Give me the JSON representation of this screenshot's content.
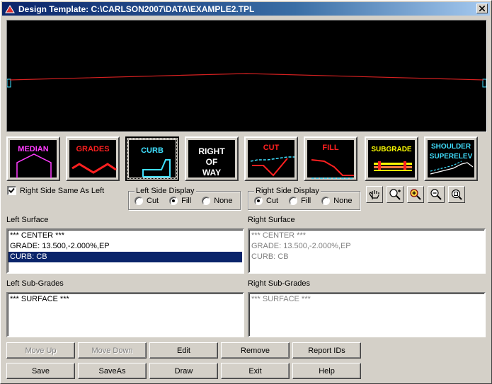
{
  "window": {
    "title": "Design Template: C:\\CARLSON2007\\DATA\\EXAMPLE2.TPL"
  },
  "template_buttons": [
    {
      "label": "MEDIAN",
      "color": "#ff3cff"
    },
    {
      "label": "GRADES",
      "color": "#ff2020"
    },
    {
      "label": "CURB",
      "color": "#40e0ff"
    },
    {
      "label_lines": [
        "RIGHT",
        "OF",
        "WAY"
      ],
      "color": "#ffffff"
    },
    {
      "label": "CUT",
      "color": "#ff2020"
    },
    {
      "label": "FILL",
      "color": "#ff2020"
    },
    {
      "label": "SUBGRADE",
      "color": "#ffff00"
    },
    {
      "label_lines": [
        "SHOULDER",
        "SUPERELEV"
      ],
      "color": "#40e0ff"
    }
  ],
  "options": {
    "right_same_as_left": {
      "label": "Right Side Same As Left",
      "checked": true
    },
    "left_display": {
      "legend": "Left Side Display",
      "options": [
        "Cut",
        "Fill",
        "None"
      ],
      "selected": "Fill"
    },
    "right_display": {
      "legend": "Right Side Display",
      "options": [
        "Cut",
        "Fill",
        "None"
      ],
      "selected": "Cut"
    }
  },
  "zoom_tools": [
    "pan-icon",
    "zoom-extents-icon",
    "zoom-in-icon",
    "zoom-out-icon",
    "zoom-window-icon"
  ],
  "left_surface": {
    "label": "Left Surface",
    "items": [
      "*** CENTER ***",
      "GRADE: 13.500,-2.000%,EP",
      "CURB: CB"
    ],
    "selected_index": 2
  },
  "right_surface": {
    "label": "Right Surface",
    "items": [
      "*** CENTER ***",
      "GRADE: 13.500,-2.000%,EP",
      "CURB: CB"
    ]
  },
  "left_subgrades": {
    "label": "Left Sub-Grades",
    "items": [
      "*** SURFACE ***"
    ]
  },
  "right_subgrades": {
    "label": "Right Sub-Grades",
    "items": [
      "*** SURFACE ***"
    ]
  },
  "buttons": {
    "move_up": "Move Up",
    "move_down": "Move Down",
    "edit": "Edit",
    "remove": "Remove",
    "report_ids": "Report IDs",
    "save": "Save",
    "save_as": "SaveAs",
    "draw": "Draw",
    "exit": "Exit",
    "help": "Help"
  },
  "colors": {
    "titlebar": "#0a246a",
    "preview_bg": "#000000",
    "profile_line": "#d42020",
    "selection": "#0a246a"
  }
}
